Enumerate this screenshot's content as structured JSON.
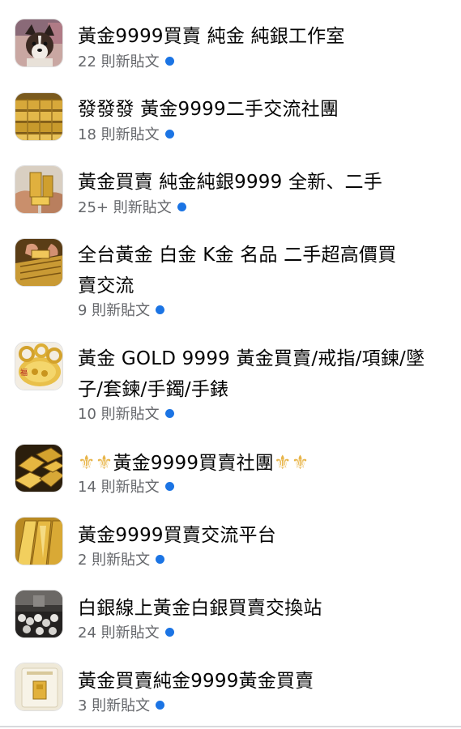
{
  "colors": {
    "unread_dot": "#1b74e4",
    "meta_text": "#65676b",
    "title_text": "#050505"
  },
  "groups": [
    {
      "name_lines": [
        "黃金9999買賣 純金 純銀工作室"
      ],
      "posts": "22 則新貼文",
      "avatar_icon": "dog-photo-thumbnail"
    },
    {
      "name_lines": [
        "發發發 黃金9999二手交流社團"
      ],
      "posts": "18 則新貼文",
      "avatar_icon": "gold-bars-stack-thumbnail"
    },
    {
      "name_lines": [
        "黃金買賣 純金純銀9999 全新、二手"
      ],
      "posts": "25+ 則新貼文",
      "avatar_icon": "gold-bars-in-hands-thumbnail"
    },
    {
      "name_lines": [
        "全台黃金 白金  K金  名品 二手超高價買",
        "賣交流"
      ],
      "posts": "9 則新貼文",
      "avatar_icon": "hands-holding-gold-thumbnail"
    },
    {
      "name_lines": [
        "黃金 GOLD 9999 黃金買賣/戒指/項鍊/墜",
        "子/套鍊/手鐲/手錶"
      ],
      "posts": "10 則新貼文",
      "avatar_icon": "gold-jewelry-platter-thumbnail"
    },
    {
      "name_pre": "⚜⚜",
      "name_mid": "黃金9999買賣社團",
      "name_post": "⚜⚜",
      "posts": "14 則新貼文",
      "avatar_icon": "gold-bars-pile-thumbnail"
    },
    {
      "name_lines": [
        "黃金9999買賣交流平台"
      ],
      "posts": "2 則新貼文",
      "avatar_icon": "shiny-gold-bars-thumbnail"
    },
    {
      "name_lines": [
        "白銀線上黃金白銀買賣交換站"
      ],
      "posts": "24 則新貼文",
      "avatar_icon": "silver-coins-table-thumbnail"
    },
    {
      "name_lines": [
        "黃金買賣純金9999黃金買賣"
      ],
      "posts": "3 則新貼文",
      "avatar_icon": "gold-bar-card-thumbnail"
    }
  ]
}
